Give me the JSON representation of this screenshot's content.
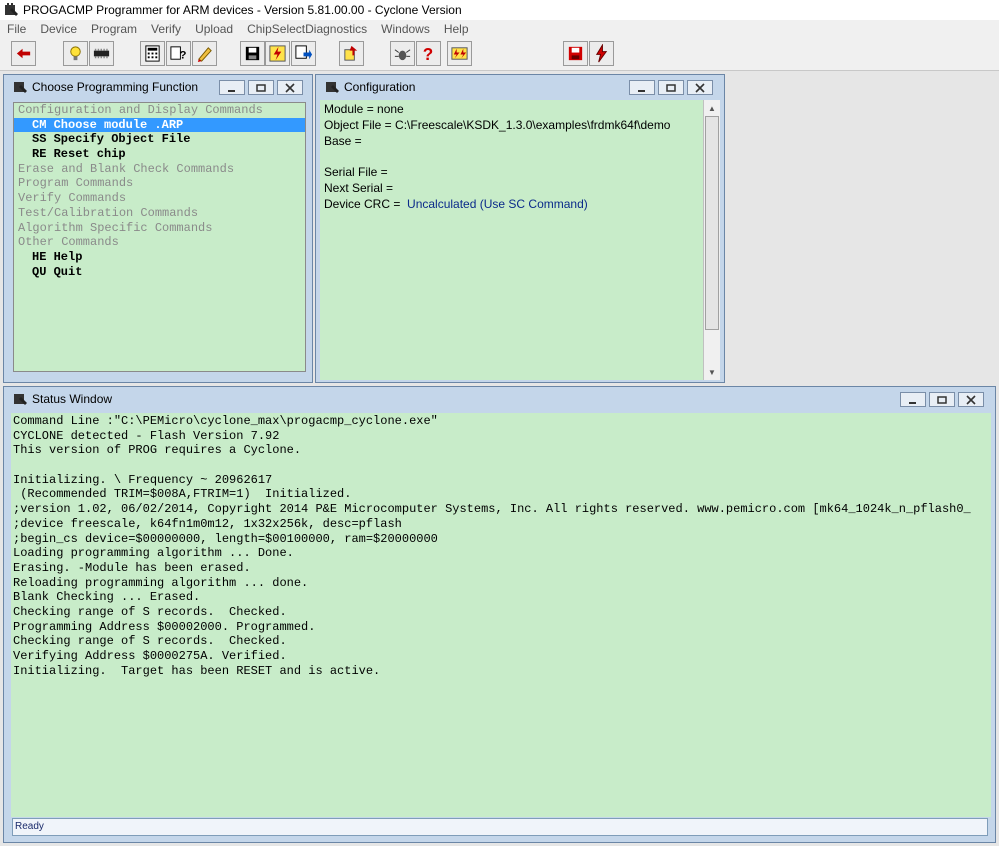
{
  "app": {
    "title": "PROGACMP Programmer for ARM devices - Version 5.81.00.00 - Cyclone Version"
  },
  "menu": [
    "File",
    "Device",
    "Program",
    "Verify",
    "Upload",
    "ChipSelectDiagnostics",
    "Windows",
    "Help"
  ],
  "toolbar": {
    "buttons": [
      {
        "icon": "back-arrow-icon"
      },
      {
        "icon": "lightbulb-icon"
      },
      {
        "icon": "chip-icon"
      },
      {
        "icon": "calculator-icon"
      },
      {
        "icon": "help-cursor-icon"
      },
      {
        "icon": "pencil-icon"
      },
      {
        "icon": "save-disk-icon"
      },
      {
        "icon": "flash-program-icon"
      },
      {
        "icon": "verify-icon"
      },
      {
        "icon": "upload-icon"
      },
      {
        "icon": "bug-icon"
      },
      {
        "icon": "question-icon"
      },
      {
        "icon": "calibrate-icon"
      },
      {
        "icon": "save-red-icon"
      },
      {
        "icon": "flash-red-icon"
      }
    ]
  },
  "choose_window": {
    "title": "Choose Programming Function",
    "lines": [
      {
        "text": "Configuration and Display Commands",
        "kind": "category"
      },
      {
        "text": "CM Choose module .ARP",
        "kind": "selected"
      },
      {
        "text": "SS Specify Object File",
        "kind": "item"
      },
      {
        "text": "RE Reset chip",
        "kind": "item"
      },
      {
        "text": "Erase and Blank Check Commands",
        "kind": "category"
      },
      {
        "text": "Program Commands",
        "kind": "category"
      },
      {
        "text": "Verify Commands",
        "kind": "category"
      },
      {
        "text": "Test/Calibration Commands",
        "kind": "category"
      },
      {
        "text": "Algorithm Specific Commands",
        "kind": "category"
      },
      {
        "text": "Other Commands",
        "kind": "category"
      },
      {
        "text": "HE Help",
        "kind": "item"
      },
      {
        "text": "QU Quit",
        "kind": "item"
      }
    ]
  },
  "config_window": {
    "title": "Configuration",
    "module": "Module = none",
    "object_file": "Object File = C:\\Freescale\\KSDK_1.3.0\\examples\\frdmk64f\\demo",
    "base": "Base =",
    "serial_file": "Serial File =",
    "next_serial": "Next Serial =",
    "device_crc_label": "Device CRC =",
    "device_crc_value": "Uncalculated (Use SC Command)"
  },
  "status_window": {
    "title": "Status Window",
    "lines": [
      "Command Line :\"C:\\PEMicro\\cyclone_max\\progacmp_cyclone.exe\"",
      "CYCLONE detected - Flash Version 7.92",
      "This version of PROG requires a Cyclone.",
      "",
      "Initializing. \\ Frequency ~ 20962617",
      " (Recommended TRIM=$008A,FTRIM=1)  Initialized.",
      ";version 1.02, 06/02/2014, Copyright 2014 P&E Microcomputer Systems, Inc. All rights reserved. www.pemicro.com [mk64_1024k_n_pflash0_",
      ";device freescale, k64fn1m0m12, 1x32x256k, desc=pflash",
      ";begin_cs device=$00000000, length=$00100000, ram=$20000000",
      "Loading programming algorithm ... Done.",
      "Erasing. -Module has been erased.",
      "Reloading programming algorithm ... done.",
      "Blank Checking ... Erased.",
      "Checking range of S records.  Checked.",
      "Programming Address $00002000. Programmed.",
      "Checking range of S records.  Checked.",
      "Verifying Address $0000275A. Verified.",
      "Initializing.  Target has been RESET and is active."
    ],
    "status_text": "Ready"
  }
}
